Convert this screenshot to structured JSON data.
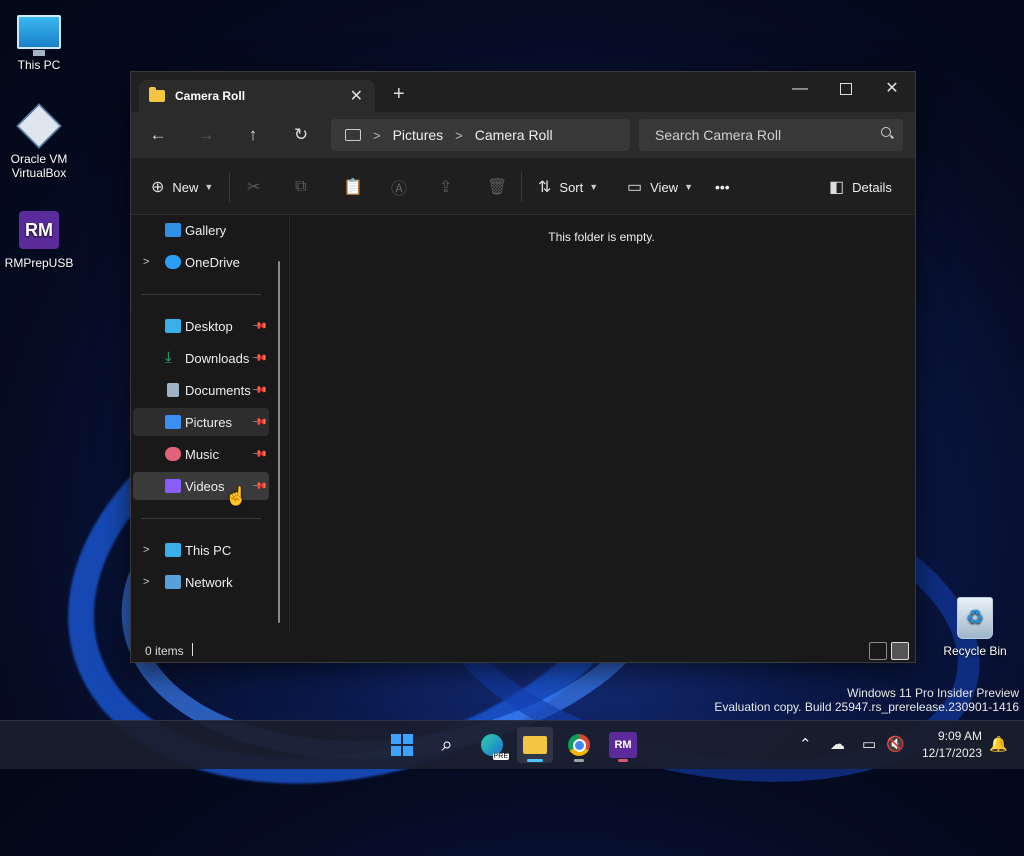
{
  "desktop": {
    "icons": [
      {
        "label": "This PC"
      },
      {
        "label": "Oracle VM VirtualBox"
      },
      {
        "label": "RMPrepUSB"
      },
      {
        "label": "Recycle Bin"
      }
    ]
  },
  "explorer": {
    "tab_title": "Camera Roll",
    "new_tab_glyph": "+",
    "breadcrumb": [
      "Pictures",
      "Camera Roll"
    ],
    "search_placeholder": "Search Camera Roll",
    "toolbar": {
      "new_label": "New",
      "sort_label": "Sort",
      "view_label": "View",
      "more_glyph": "•••",
      "details_label": "Details"
    },
    "sidebar": {
      "top": [
        {
          "label": "Gallery",
          "icon": "gallery-icon",
          "color": "#2f8fe6"
        },
        {
          "label": "OneDrive",
          "icon": "cloud-icon",
          "color": "#2a9df4"
        }
      ],
      "quick_access": [
        {
          "label": "Desktop",
          "icon": "desktop-icon",
          "color": "#3bb0e8"
        },
        {
          "label": "Downloads",
          "icon": "download-icon",
          "color": "#2fbf71"
        },
        {
          "label": "Documents",
          "icon": "document-icon",
          "color": "#9fb2c8"
        },
        {
          "label": "Pictures",
          "icon": "pictures-icon",
          "color": "#3a8ff0"
        },
        {
          "label": "Music",
          "icon": "music-icon",
          "color": "#e0637a"
        },
        {
          "label": "Videos",
          "icon": "videos-icon",
          "color": "#8b5cf6"
        }
      ],
      "locations": [
        {
          "label": "This PC",
          "icon": "pc-icon",
          "color": "#3bb0e8"
        },
        {
          "label": "Network",
          "icon": "network-icon",
          "color": "#5aa0d8"
        }
      ]
    },
    "empty_message": "This folder is empty.",
    "status_count": "0 items"
  },
  "watermark": {
    "line1": "Windows 11 Pro Insider Preview",
    "line2": "Evaluation copy. Build 25947.rs_prerelease.230901-1416"
  },
  "taskbar": {
    "rm_label": "RM",
    "edge_badge": "PRE",
    "time": "9:09 AM",
    "date": "12/17/2023"
  }
}
